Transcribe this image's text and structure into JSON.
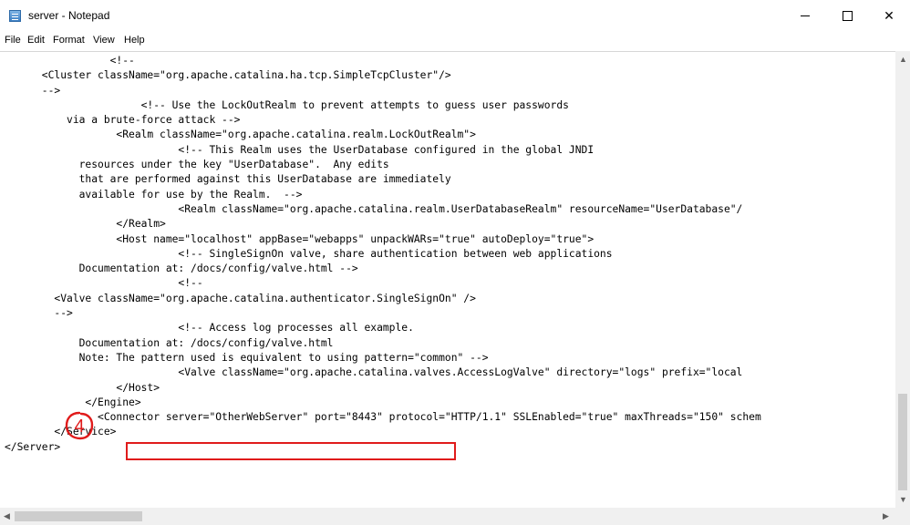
{
  "window": {
    "title": "server - Notepad",
    "minimize_icon": "minimize-icon",
    "maximize_icon": "maximize-icon",
    "close_icon": "close-icon",
    "close_glyph": "✕"
  },
  "menu": {
    "items": [
      "File",
      "Edit",
      "Format",
      "View",
      "Help"
    ]
  },
  "editor": {
    "lines": [
      "                 <!--",
      "      <Cluster className=\"org.apache.catalina.ha.tcp.SimpleTcpCluster\"/>",
      "      -->",
      "                      <!-- Use the LockOutRealm to prevent attempts to guess user passwords",
      "          via a brute-force attack -->",
      "                  <Realm className=\"org.apache.catalina.realm.LockOutRealm\">",
      "                            <!-- This Realm uses the UserDatabase configured in the global JNDI",
      "            resources under the key \"UserDatabase\".  Any edits",
      "            that are performed against this UserDatabase are immediately",
      "            available for use by the Realm.  -->",
      "                            <Realm className=\"org.apache.catalina.realm.UserDatabaseRealm\" resourceName=\"UserDatabase\"/",
      "                  </Realm>",
      "                  <Host name=\"localhost\" appBase=\"webapps\" unpackWARs=\"true\" autoDeploy=\"true\">",
      "                            <!-- SingleSignOn valve, share authentication between web applications",
      "            Documentation at: /docs/config/valve.html -->",
      "                            <!--",
      "        <Valve className=\"org.apache.catalina.authenticator.SingleSignOn\" />",
      "        -->",
      "                            <!-- Access log processes all example.",
      "            Documentation at: /docs/config/valve.html",
      "            Note: The pattern used is equivalent to using pattern=\"common\" -->",
      "                            <Valve className=\"org.apache.catalina.valves.AccessLogValve\" directory=\"logs\" prefix=\"local",
      "                  </Host>",
      "             </Engine>",
      "               <Connector server=\"OtherWebServer\" port=\"8443\" protocol=\"HTTP/1.1\" SSLEnabled=\"true\" maxThreads=\"150\" schem",
      "        </Service>",
      "</Server>"
    ]
  },
  "annotation": {
    "step_number": "4",
    "color": "#e01b1b"
  },
  "scrollbars": {
    "up_arrow": "▲",
    "down_arrow": "▼",
    "left_arrow": "◀",
    "right_arrow": "▶"
  }
}
